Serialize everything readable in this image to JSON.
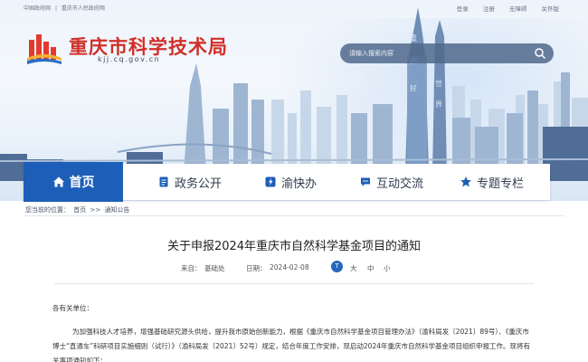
{
  "topbar": {
    "left_links": [
      "中国政府网",
      "|",
      "重庆市人民政府网"
    ],
    "right_links": [
      "登录",
      "注册",
      "无障碍",
      "关怀版"
    ]
  },
  "header": {
    "site_title": "重庆市科学技术局",
    "domain": "kjj.cq.gov.cn",
    "search_placeholder": "请输入搜索内容"
  },
  "nav": {
    "items": [
      {
        "label": "首页",
        "icon": "home-icon",
        "active": true
      },
      {
        "label": "政务公开",
        "icon": "document-icon"
      },
      {
        "label": "渝快办",
        "icon": "lightning-icon"
      },
      {
        "label": "互动交流",
        "icon": "chat-icon"
      },
      {
        "label": "专题专栏",
        "icon": "star-icon"
      }
    ]
  },
  "breadcrumb": {
    "prefix": "您当前的位置：",
    "items": [
      "首页",
      ">>",
      "通知公告"
    ]
  },
  "article": {
    "title": "关于申报2024年重庆市自然科学基金项目的通知",
    "source_label": "来自：",
    "source": "基础处",
    "date_label": "日期：",
    "date": "2024-02-08",
    "font_icon_glyph": "T",
    "font_sizes": [
      "大",
      "中",
      "小"
    ],
    "salutation": "各有关单位：",
    "paragraph1": "为加强科技人才培养，增强基础研究源头供给，提升我市原始创新能力，根据《重庆市自然科学基金项目管理办法》（渝科局发〔2021〕89号）、《重庆市博士“直通车”科研项目实施细则（试行）》（渝科局发〔2021〕52号）规定，结合年度工作安排，现启动2024年重庆市自然科学基金项目组织申报工作。现将有关事项通知如下："
  },
  "colors": {
    "title_red": "#d0302a",
    "nav_active": "#1d5fb8"
  }
}
